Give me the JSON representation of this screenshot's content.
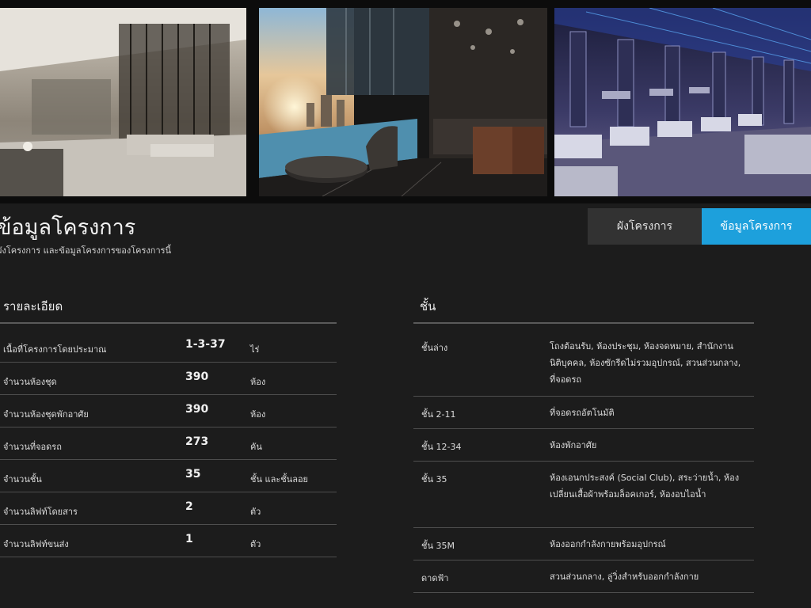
{
  "project": {
    "title": "ข้อมูลโครงการ",
    "subtitle": "ผังโครงการ และข้อมูลโครงการของโครงการนี้"
  },
  "tabs": [
    {
      "label": "ผังโครงการ",
      "active": false
    },
    {
      "label": "ข้อมูลโครงการ",
      "active": true
    }
  ],
  "details": {
    "heading": "รายละเอียด",
    "rows": [
      {
        "label": "เนื้อที่โครงการโดยประมาณ",
        "value": "1-3-37",
        "unit": "ไร่"
      },
      {
        "label": "จำนวนห้องชุด",
        "value": "390",
        "unit": "ห้อง"
      },
      {
        "label": "จำนวนห้องชุดพักอาศัย",
        "value": "390",
        "unit": "ห้อง"
      },
      {
        "label": "จำนวนที่จอดรถ",
        "value": "273",
        "unit": "คัน"
      },
      {
        "label": "จำนวนชั้น",
        "value": "35",
        "unit": "ชั้น และชั้นลอย"
      },
      {
        "label": "จำนวนลิฟท์โดยสาร",
        "value": "2",
        "unit": "ตัว"
      },
      {
        "label": "จำนวนลิฟท์ขนส่ง",
        "value": "1",
        "unit": "ตัว"
      }
    ]
  },
  "floors": {
    "heading": "ชั้น",
    "rows": [
      {
        "floor": "ชั้นล่าง",
        "description": "โถงต้อนรับ, ห้องประชุม, ห้องจดหมาย, สำนักงานนิติบุคคล, ห้องซักรีดไม่รวมอุปกรณ์, สวนส่วนกลาง, ที่จอดรถ"
      },
      {
        "floor": "ชั้น 2-11",
        "description": "ที่จอดรถอัตโนมัติ"
      },
      {
        "floor": "ชั้น 12-34",
        "description": "ห้องพักอาศัย"
      },
      {
        "floor": "ชั้น 35",
        "description": "ห้องเอนกประสงค์ (Social Club), สระว่ายน้ำ, ห้องเปลี่ยนเสื้อผ้าพร้อมล็อคเกอร์, ห้องอบไอน้ำ"
      },
      {
        "floor": "ชั้น 35M",
        "description": "ห้องออกกำลังกายพร้อมอุปกรณ์"
      },
      {
        "floor": "ดาดฟ้า",
        "description": "สวนส่วนกลาง, ลู่วิ่งสำหรับออกกำลังกาย"
      }
    ]
  },
  "gallery": [
    {
      "icon": "lobby-photo"
    },
    {
      "icon": "pool-lounge-photo"
    },
    {
      "icon": "fitness-photo"
    }
  ],
  "colors": {
    "accent": "#1da0dc",
    "panel": "#1c1c1c",
    "tab_inactive": "#323232"
  }
}
